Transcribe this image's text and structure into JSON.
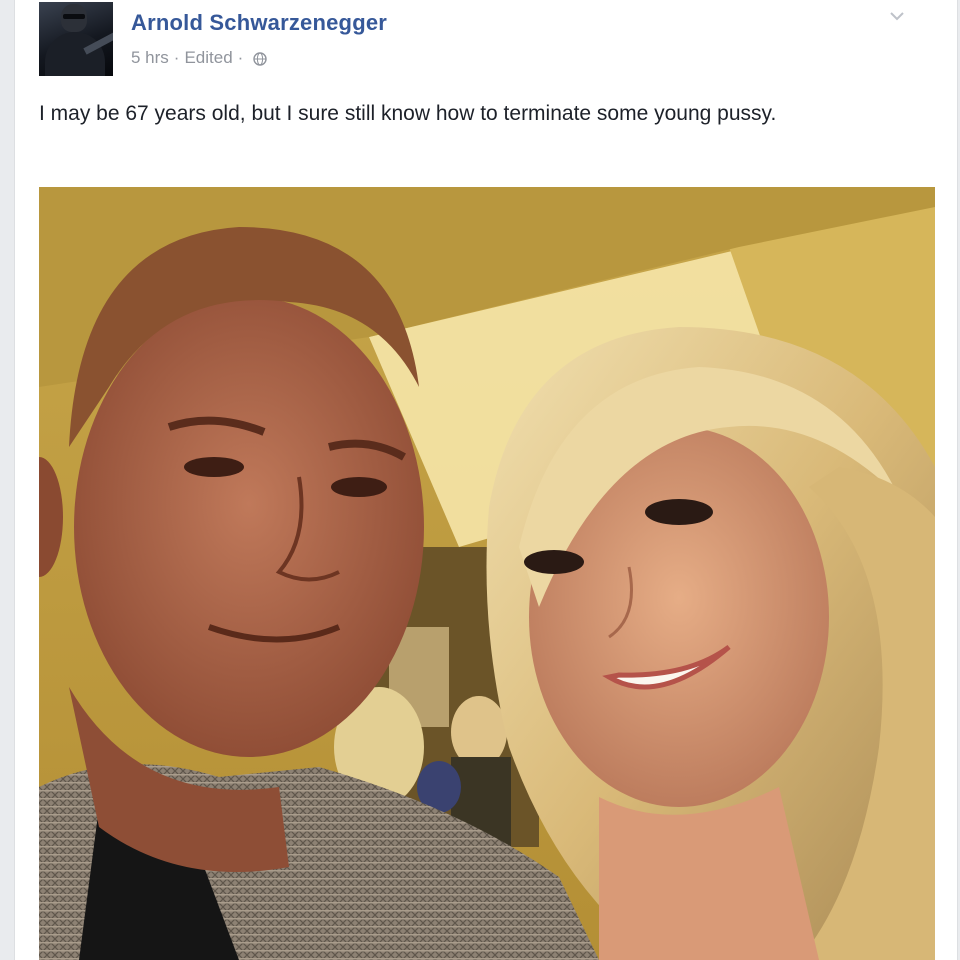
{
  "post": {
    "author": "Arnold Schwarzenegger",
    "time": "5 hrs",
    "separator": "·",
    "edited": "Edited",
    "audience_icon": "globe-icon",
    "menu_icon": "chevron-down-icon",
    "text": "I may be 67 years old, but I sure still know how to terminate some young pussy."
  },
  "colors": {
    "author_link": "#365899",
    "meta_text": "#90949c",
    "body_text": "#1d2129"
  }
}
